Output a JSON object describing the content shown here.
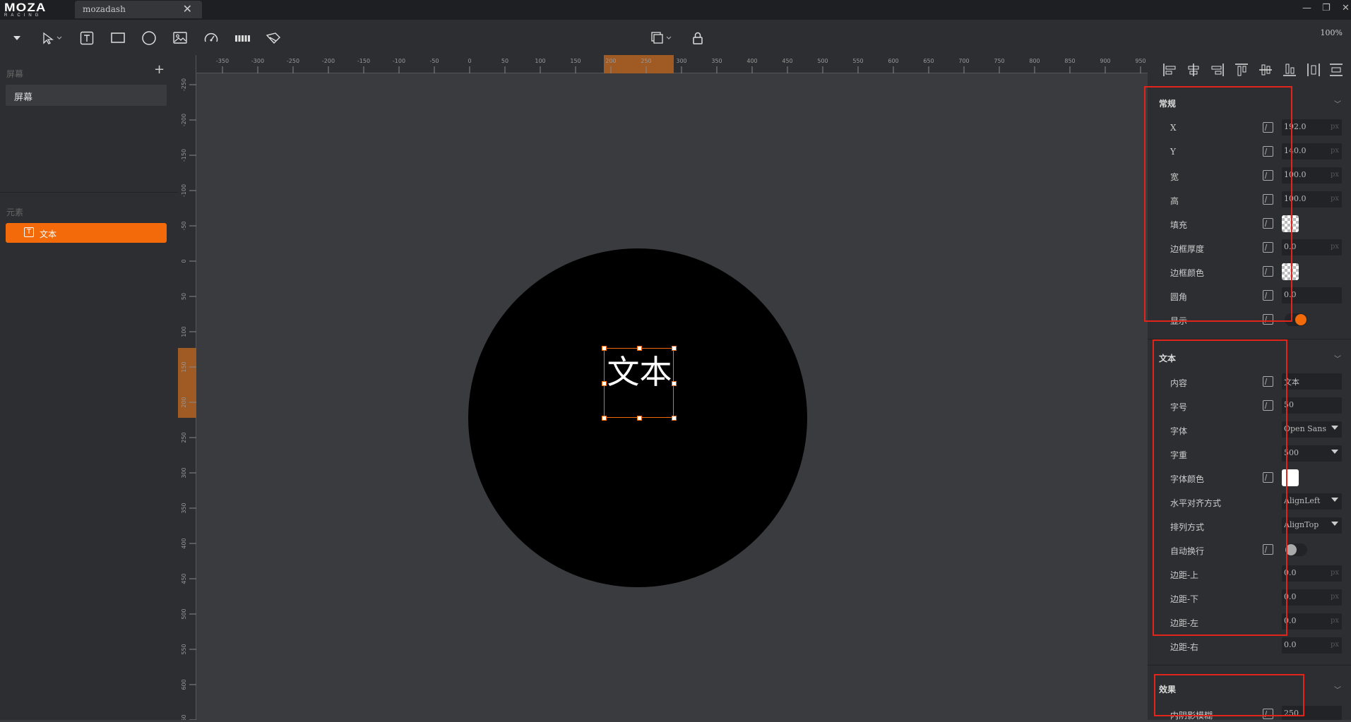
{
  "app": {
    "logo_main": "MOZA",
    "logo_sub": "RACING",
    "tab_label": "mozadash",
    "zoom": "100%"
  },
  "toolbar": {
    "tools": [
      "dropdown-arrow-icon",
      "select-pointer-icon",
      "text-tool-icon",
      "rectangle-tool-icon",
      "ellipse-tool-icon",
      "image-tool-icon",
      "gauge-tool-icon",
      "bar-tool-icon",
      "path-tool-icon"
    ],
    "center": [
      "layer-order-icon",
      "lock-icon"
    ]
  },
  "left": {
    "screens_title": "屏幕",
    "screen_item": "屏幕",
    "elements_title": "元素",
    "element_item": "文本"
  },
  "rulers": {
    "h": [
      "-350",
      "-300",
      "-250",
      "-200",
      "-150",
      "-100",
      "-50",
      "0",
      "50",
      "100",
      "150",
      "200",
      "250",
      "300",
      "350",
      "400",
      "450",
      "500",
      "550",
      "600",
      "650",
      "700",
      "750",
      "800",
      "850",
      "900",
      "950"
    ],
    "v": [
      "-250",
      "-200",
      "-150",
      "-100",
      "-50",
      "0",
      "50",
      "100",
      "150",
      "200",
      "250",
      "300",
      "350",
      "400",
      "450",
      "500",
      "550",
      "600",
      "650"
    ]
  },
  "canvas": {
    "text": "文本"
  },
  "props": {
    "general": {
      "title": "常规",
      "x_label": "X",
      "x_value": "192.0",
      "y_label": "Y",
      "y_value": "140.0",
      "w_label": "宽",
      "w_value": "100.0",
      "h_label": "高",
      "h_value": "100.0",
      "fill_label": "填充",
      "border_width_label": "边框厚度",
      "border_width_value": "0.0",
      "border_color_label": "边框颜色",
      "radius_label": "圆角",
      "radius_value": "0.0",
      "visible_label": "显示",
      "visible_on": true,
      "unit": "px"
    },
    "text": {
      "title": "文本",
      "content_label": "内容",
      "content_value": "文本",
      "size_label": "字号",
      "size_value": "50",
      "font_label": "字体",
      "font_value": "Open Sans",
      "weight_label": "字重",
      "weight_value": "500",
      "color_label": "字体颜色",
      "halign_label": "水平对齐方式",
      "halign_value": "AlignLeft",
      "layout_label": "排列方式",
      "layout_value": "AlignTop",
      "wrap_label": "自动换行",
      "wrap_on": false,
      "pad_top_label": "边距-上",
      "pad_top_value": "0.0",
      "pad_bottom_label": "边距-下",
      "pad_bottom_value": "0.0",
      "pad_left_label": "边距-左",
      "pad_left_value": "0.0",
      "pad_right_label": "边距-右",
      "pad_right_value": "0.0"
    },
    "effects": {
      "title": "效果",
      "blur_label": "内阴影模糊",
      "blur_value": "250"
    }
  },
  "colors": {
    "accent": "#f26a0a",
    "highlight": "#e1251b"
  }
}
